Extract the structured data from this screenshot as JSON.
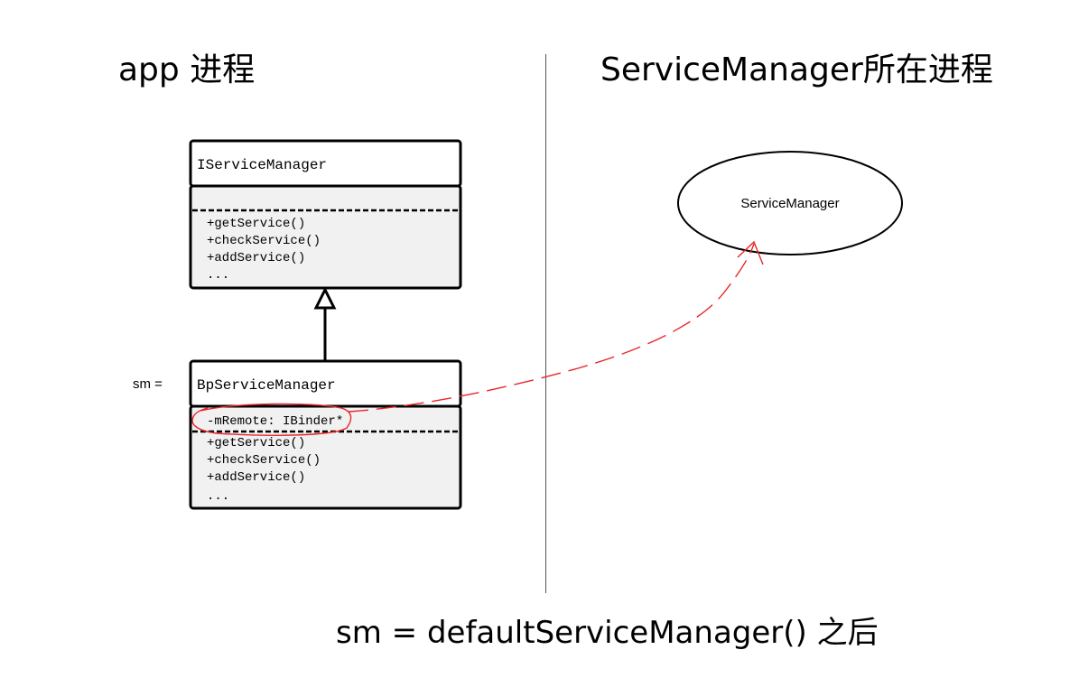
{
  "headings": {
    "app_process": "app 进程",
    "servicemanager_process": "ServiceManager所在进程"
  },
  "interface_class": {
    "name": "IServiceManager",
    "methods": [
      "+getService()",
      "+checkService()",
      "+addService()",
      "..."
    ]
  },
  "proxy_class": {
    "name": "BpServiceManager",
    "field": "-mRemote: IBinder*",
    "methods": [
      "+getService()",
      "+checkService()",
      "+addService()",
      "..."
    ]
  },
  "sm_label": "sm =",
  "ellipse_label": "ServiceManager",
  "caption": "sm = defaultServiceManager() 之后",
  "colors": {
    "annotation": "#e8262a",
    "box_fill": "#f1f1f1",
    "line": "#000000"
  }
}
